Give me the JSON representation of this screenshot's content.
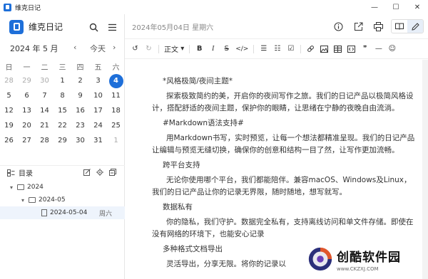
{
  "window": {
    "title": "维克日记",
    "minimize": "—",
    "maximize": "☐",
    "close": "✕"
  },
  "sidebar": {
    "app_name": "维克日记",
    "calendar": {
      "month_label": "2024 年 5 月",
      "prev": "‹",
      "today_label": "今天",
      "next": "›",
      "weekdays": [
        "日",
        "一",
        "二",
        "三",
        "四",
        "五",
        "六"
      ],
      "days": [
        "28",
        "29",
        "30",
        "1",
        "2",
        "3",
        "4",
        "5",
        "6",
        "7",
        "8",
        "9",
        "10",
        "11",
        "12",
        "13",
        "14",
        "15",
        "16",
        "17",
        "18",
        "19",
        "20",
        "21",
        "22",
        "23",
        "24",
        "25",
        "26",
        "27",
        "28",
        "29",
        "30",
        "31",
        "1"
      ],
      "selected_day": "4"
    },
    "directory": {
      "label": "目录",
      "tree": [
        {
          "label": "2024"
        },
        {
          "label": "2024-05"
        },
        {
          "label": "2024-05-04",
          "weekday": "周六"
        }
      ]
    }
  },
  "main": {
    "date_label": "2024年05月04日 星期六",
    "toolbar": {
      "paragraph_label": "正文"
    },
    "content": [
      {
        "kind": "h",
        "text": "*风格极简/夜间主题*"
      },
      {
        "kind": "body",
        "text": "探索极致简约的美，开启你的夜间写作之旅。我们的日记产品以极简风格设计，搭配舒适的夜间主题，保护你的眼睛，让思绪在宁静的夜晚自由流淌。"
      },
      {
        "kind": "h",
        "text": "#Markdown语法支持#"
      },
      {
        "kind": "body",
        "text": "用Markdown书写，实时预览，让每一个想法都精准呈现。我们的日记产品让编辑与预览无缝切换，确保你的创意和结构一目了然，让写作更加流畅。"
      },
      {
        "kind": "h",
        "text": "跨平台支持"
      },
      {
        "kind": "body",
        "text": "无论你使用哪个平台，我们都能陪伴。兼容macOS、Windows及Linux，我们的日记产品让你的记录无界限，随时随地，想写就写。"
      },
      {
        "kind": "h",
        "text": "数据私有"
      },
      {
        "kind": "body",
        "text": "你的隐私，我们守护。数据完全私有，支持离线访问和单文件存储。即使在没有网络的环境下，也能安心记录"
      },
      {
        "kind": "h",
        "text": "多种格式文档导出"
      },
      {
        "kind": "body",
        "text": "灵活导出，分享无限。将你的记录以"
      }
    ]
  },
  "watermark": {
    "name": "创酷软件园",
    "url": "www.CKZXJ.COM"
  },
  "colors": {
    "accent": "#1e6fd9"
  }
}
